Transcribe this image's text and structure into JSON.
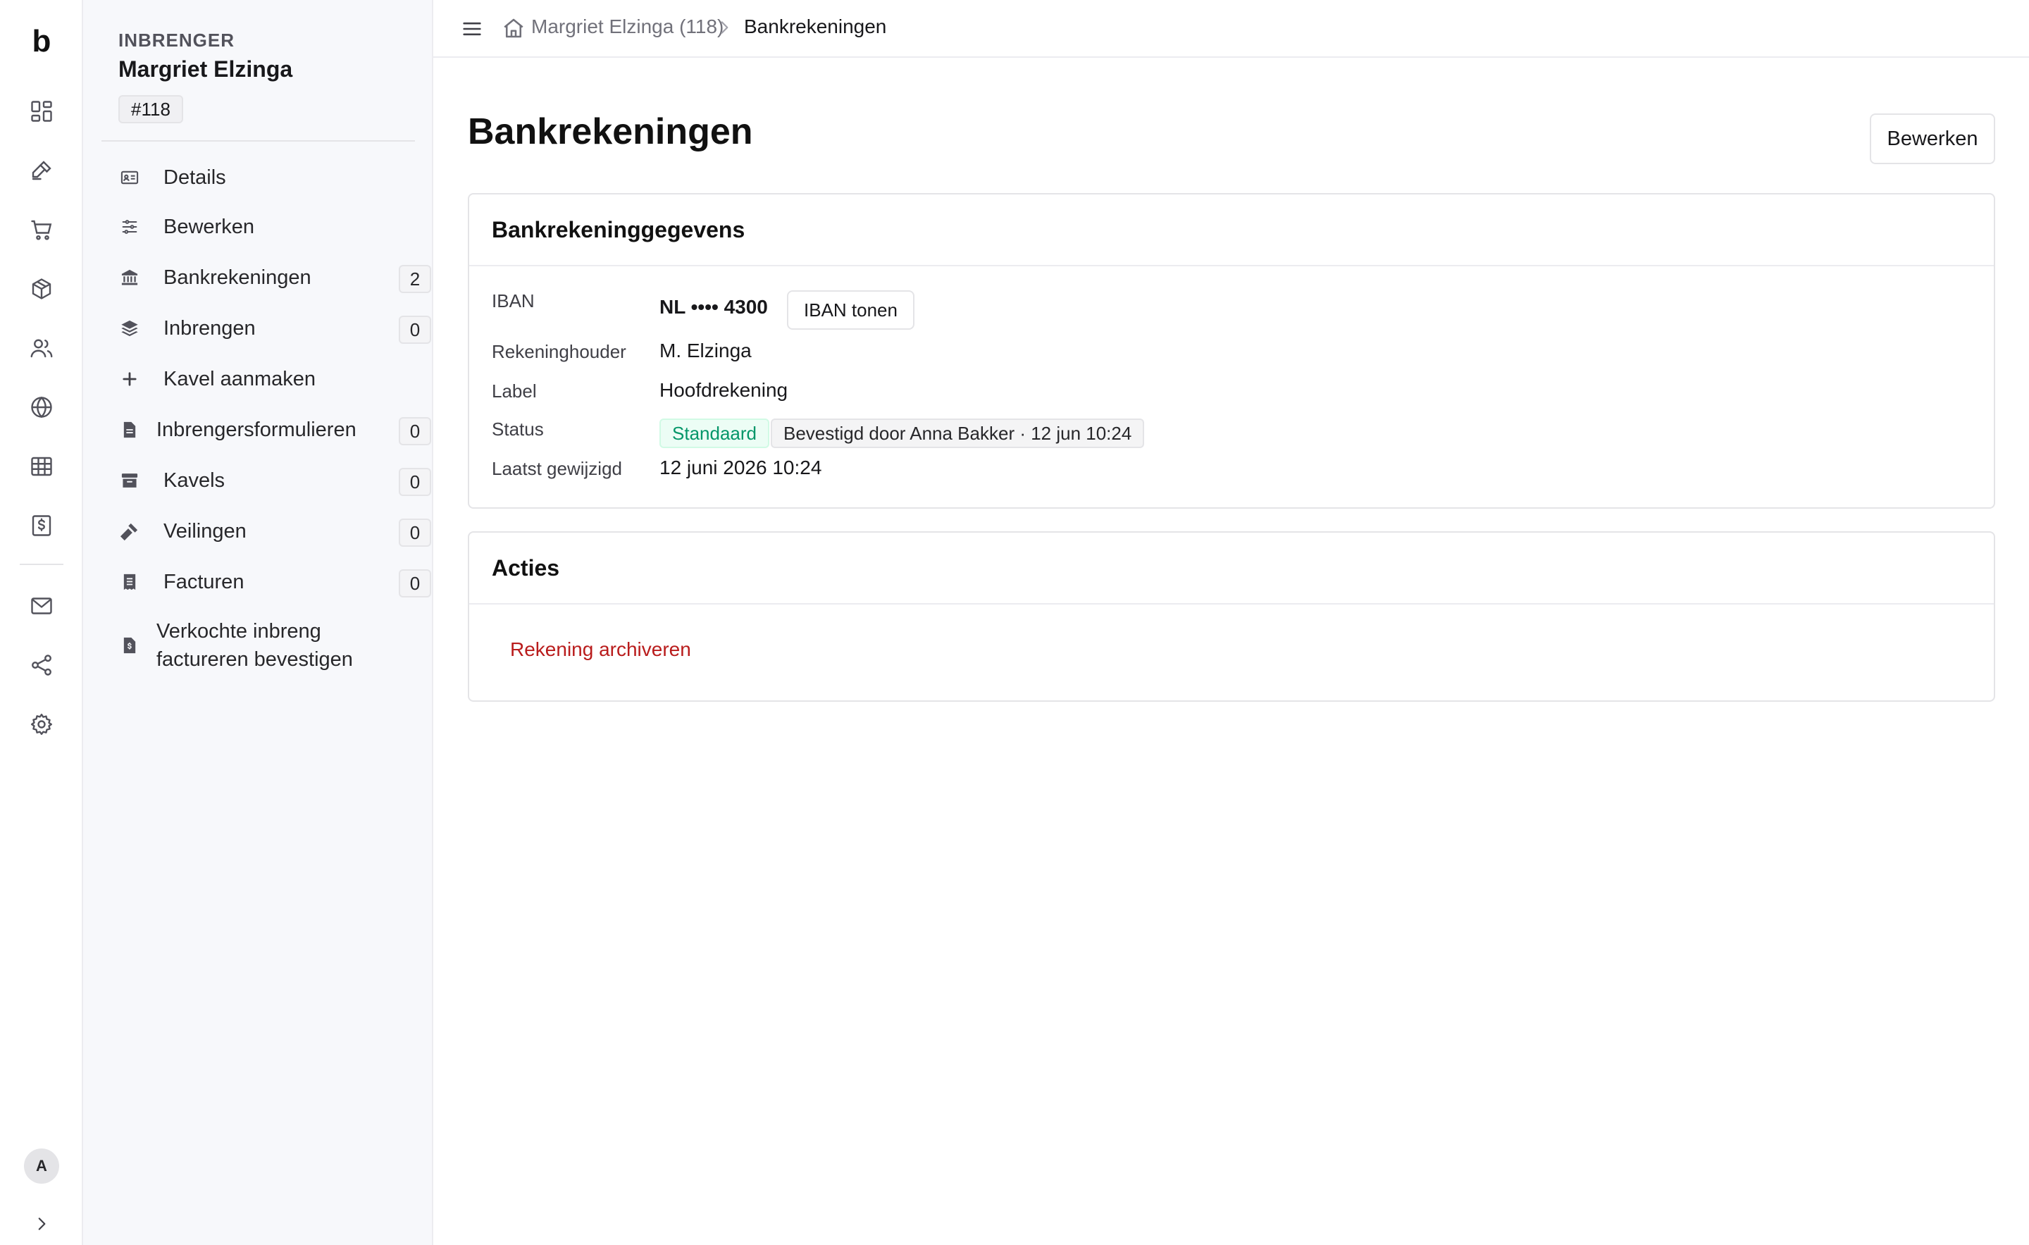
{
  "rail": {
    "logo": "b",
    "avatar_initial": "A"
  },
  "subnav": {
    "kicker": "INBRENGER",
    "person_name": "Margriet Elzinga",
    "id_badge": "#118",
    "items": [
      {
        "label": "Details",
        "count": ""
      },
      {
        "label": "Bewerken",
        "count": ""
      },
      {
        "label": "Bankrekeningen",
        "count": "2"
      },
      {
        "label": "Inbrengen",
        "count": "0"
      },
      {
        "label": "Kavel aanmaken",
        "count": ""
      },
      {
        "label": "Inbrengersformulieren",
        "count": "0"
      },
      {
        "label": "Kavels",
        "count": "0"
      },
      {
        "label": "Veilingen",
        "count": "0"
      },
      {
        "label": "Facturen",
        "count": "0"
      },
      {
        "label_line1": "Verkochte inbreng",
        "label_line2": "factureren bevestigen"
      }
    ]
  },
  "breadcrumb": {
    "parent": "Margriet Elzinga (118)",
    "current": "Bankrekeningen"
  },
  "page": {
    "title": "Bankrekeningen",
    "edit_button": "Bewerken"
  },
  "details_card": {
    "title": "Bankrekeninggegevens",
    "iban_label": "IBAN",
    "iban_value": "NL •••• 4300",
    "iban_button": "IBAN tonen",
    "holder_label": "Rekeninghouder",
    "holder_value": "M. Elzinga",
    "label_label": "Label",
    "label_value": "Hoofdrekening",
    "status_label": "Status",
    "status_badge": "Standaard",
    "status_confirmed": "Bevestigd door Anna Bakker · 12 jun 10:24",
    "modified_label": "Laatst gewijzigd",
    "modified_value": "12 juni 2026 10:24"
  },
  "actions_card": {
    "title": "Acties",
    "archive_link": "Rekening archiveren"
  },
  "colors": {
    "danger": "#b91c1c",
    "success": "#059669",
    "sidebar_bg": "#f7f8fb"
  }
}
